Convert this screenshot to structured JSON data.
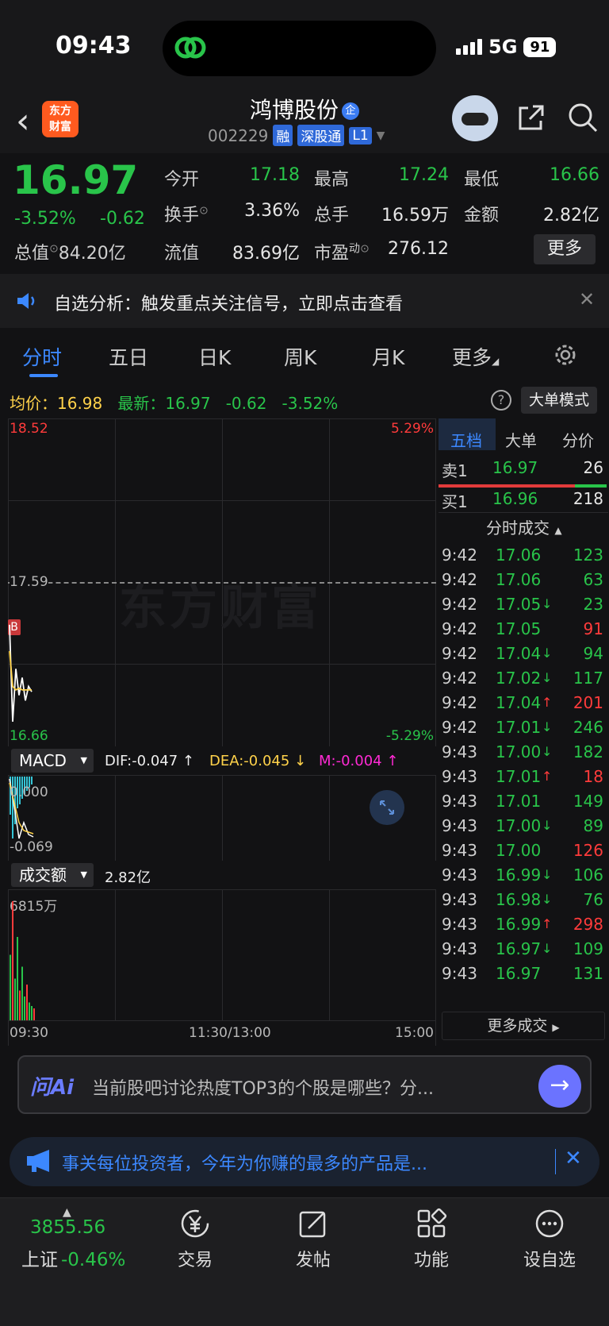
{
  "status_bar": {
    "time": "09:43",
    "network": "5G",
    "battery": "91"
  },
  "header": {
    "back_icon": "chevron-left-icon",
    "app_logo": "东方财富",
    "stock_name": "鸿博股份",
    "qi_badge": "企",
    "stock_code": "002229",
    "tags": [
      "融",
      "深股通",
      "L1"
    ]
  },
  "quote": {
    "price": "16.97",
    "change_pct": "-3.52%",
    "change": "-0.62",
    "open_label": "今开",
    "open_value": "17.18",
    "high_label": "最高",
    "high_value": "17.24",
    "low_label": "最低",
    "low_value": "16.66",
    "turnover_label": "换手",
    "turnover_value": "3.36%",
    "volume_label": "总手",
    "volume_value": "16.59万",
    "amount_label": "金额",
    "amount_value": "2.82亿",
    "total_cap_label": "总值",
    "total_cap_value": "84.20亿",
    "float_cap_label": "流值",
    "float_cap_value": "83.69亿",
    "pe_label": "市盈",
    "pe_super": "动",
    "pe_value": "276.12",
    "more_button": "更多"
  },
  "notice": {
    "text": "自选分析：触发重点关注信号，立即点击查看"
  },
  "tabs": [
    "分时",
    "五日",
    "日K",
    "周K",
    "月K",
    "更多"
  ],
  "avg_row": {
    "avg_label": "均价：",
    "avg_value": "16.98",
    "latest_label": "最新：",
    "latest_value": "16.97",
    "latest_change": "-0.62",
    "latest_pct": "-3.52%",
    "big_order_button": "大单模式"
  },
  "chart": {
    "price_top": "18.52",
    "pct_top": "5.29%",
    "price_mid": "17.59",
    "price_bottom": "16.66",
    "pct_bottom": "-5.29%",
    "watermark": "东方财富",
    "b_marker": "B",
    "macd_select": "MACD",
    "dif": "DIF:-0.047 ↑",
    "dea": "DEA:-0.045 ↓",
    "m": "M:-0.004 ↑",
    "macd_top": "0.000",
    "macd_bottom": "-0.069",
    "vol_select": "成交额",
    "vol_value": "2.82亿",
    "vol_top": "6815万",
    "time_start": "09:30",
    "time_mid": "11:30/13:00",
    "time_end": "15:00"
  },
  "chart_data": {
    "type": "line",
    "title": "",
    "series": [
      {
        "values": [
          17.35,
          16.8,
          17.1,
          16.95,
          17.05,
          16.92,
          17.0,
          16.97
        ]
      },
      {
        "values": [
          17.2,
          17.0,
          16.98,
          16.99,
          16.98,
          16.98,
          16.98,
          16.98
        ]
      }
    ],
    "ylim": [
      16.66,
      18.52
    ],
    "volume": [
      0.55,
      1.0,
      0.35,
      0.7,
      0.25,
      0.45,
      0.2,
      0.3,
      0.15,
      0.12,
      0.1
    ]
  },
  "book": {
    "tabs": [
      "五档",
      "大单",
      "分价"
    ],
    "sell1": {
      "label": "卖1",
      "price": "16.97",
      "vol": "26"
    },
    "buy1": {
      "label": "买1",
      "price": "16.96",
      "vol": "218"
    },
    "ticks_title": "分时成交",
    "ticks": [
      {
        "t": "9:42",
        "p": "17.06",
        "a": "",
        "v": "123",
        "c": "green"
      },
      {
        "t": "9:42",
        "p": "17.06",
        "a": "",
        "v": "63",
        "c": "green"
      },
      {
        "t": "9:42",
        "p": "17.05",
        "a": "↓",
        "v": "23",
        "c": "green"
      },
      {
        "t": "9:42",
        "p": "17.05",
        "a": "",
        "v": "91",
        "c": "red"
      },
      {
        "t": "9:42",
        "p": "17.04",
        "a": "↓",
        "v": "94",
        "c": "green"
      },
      {
        "t": "9:42",
        "p": "17.02",
        "a": "↓",
        "v": "117",
        "c": "green"
      },
      {
        "t": "9:42",
        "p": "17.04",
        "a": "↑",
        "v": "201",
        "c": "red"
      },
      {
        "t": "9:42",
        "p": "17.01",
        "a": "↓",
        "v": "246",
        "c": "green"
      },
      {
        "t": "9:43",
        "p": "17.00",
        "a": "↓",
        "v": "182",
        "c": "green"
      },
      {
        "t": "9:43",
        "p": "17.01",
        "a": "↑",
        "v": "18",
        "c": "red"
      },
      {
        "t": "9:43",
        "p": "17.01",
        "a": "",
        "v": "149",
        "c": "green"
      },
      {
        "t": "9:43",
        "p": "17.00",
        "a": "↓",
        "v": "89",
        "c": "green"
      },
      {
        "t": "9:43",
        "p": "17.00",
        "a": "",
        "v": "126",
        "c": "red"
      },
      {
        "t": "9:43",
        "p": "16.99",
        "a": "↓",
        "v": "106",
        "c": "green"
      },
      {
        "t": "9:43",
        "p": "16.98",
        "a": "↓",
        "v": "76",
        "c": "green"
      },
      {
        "t": "9:43",
        "p": "16.99",
        "a": "↑",
        "v": "298",
        "c": "red"
      },
      {
        "t": "9:43",
        "p": "16.97",
        "a": "↓",
        "v": "109",
        "c": "green"
      },
      {
        "t": "9:43",
        "p": "16.97",
        "a": "",
        "v": "131",
        "c": "green"
      }
    ],
    "more_ticks": "更多成交"
  },
  "ai": {
    "logo": "问Ai",
    "placeholder": "当前股吧讨论热度TOP3的个股是哪些？分..."
  },
  "promo": {
    "text": "事关每位投资者，今年为你赚的最多的产品是..."
  },
  "bottom_nav": {
    "index_value": "3855.56",
    "index_name": "上证",
    "index_pct": "-0.46%",
    "items": [
      "交易",
      "发帖",
      "功能",
      "设自选"
    ]
  },
  "colors": {
    "up": "#ff3b3b",
    "down": "#29c44a",
    "accent": "#3c88ff",
    "avg": "#ffd24a"
  }
}
